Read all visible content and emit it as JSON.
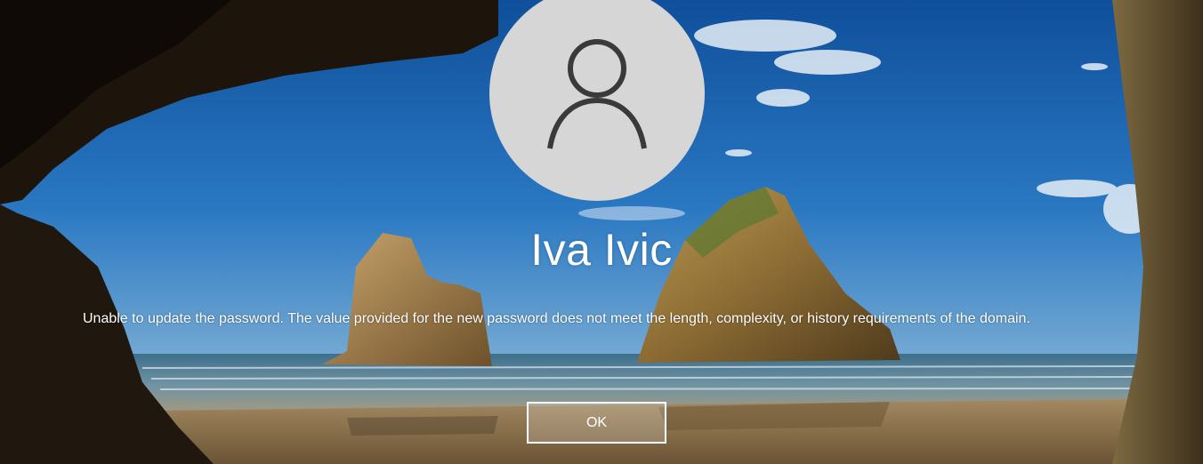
{
  "login": {
    "avatar_icon": "user-silhouette-icon",
    "username": "Iva Ivic",
    "message": "Unable to update the password. The value provided for the new password does not meet the length, complexity, or history requirements of the domain.",
    "ok_label": "OK"
  },
  "colors": {
    "avatar_bg": "#d6d6d6",
    "avatar_fg": "#3a3a3a",
    "text": "#ffffff",
    "sky": "#1c5fa8"
  }
}
